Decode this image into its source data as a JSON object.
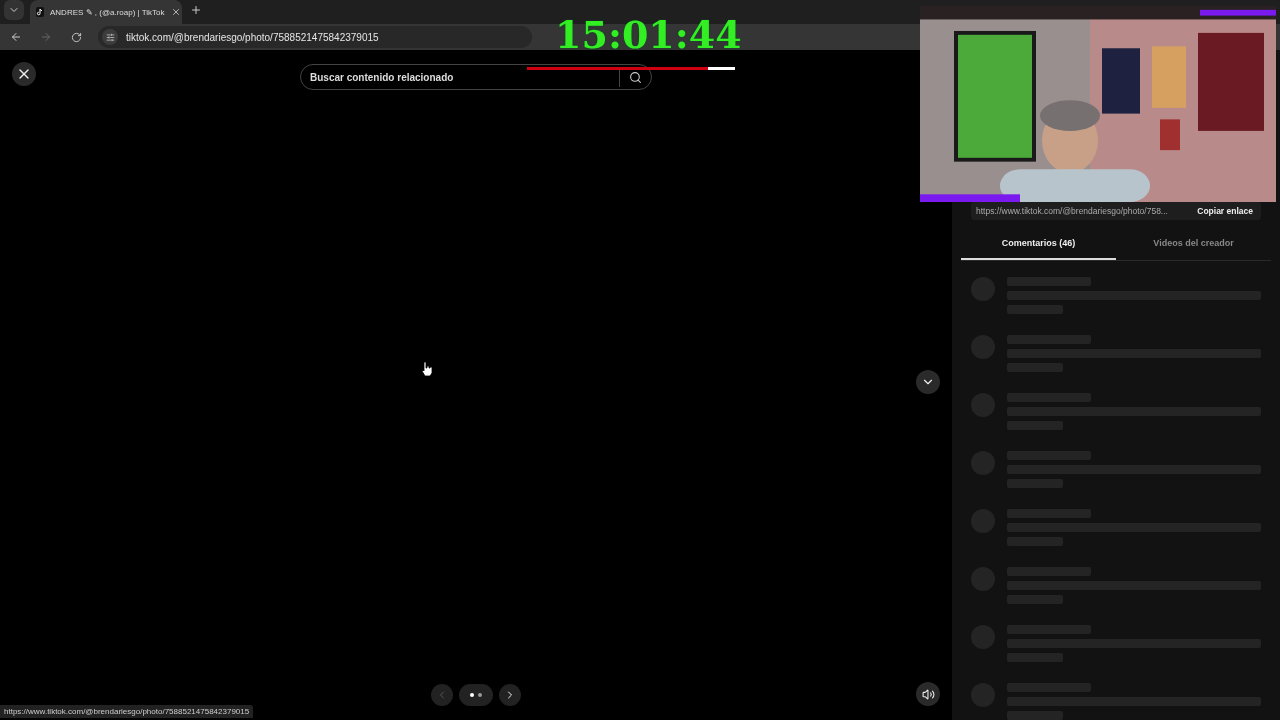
{
  "browser": {
    "tab": {
      "title": "ANDRES ✎ , (@a.roap) | TikTok",
      "selected": true
    },
    "nav": {
      "back_disabled": false,
      "forward_disabled": true
    },
    "url": "tiktok.com/@brendariesgo/photo/7588521475842379015"
  },
  "overlay": {
    "timer": "15:01:44",
    "progress": {
      "level": 0.87
    }
  },
  "viewer": {
    "search": {
      "placeholder": "Buscar contenido relacionado"
    },
    "carousel": {
      "prev_disabled": true,
      "next_disabled": false,
      "dots": [
        {
          "selected": true
        },
        {
          "selected": false
        }
      ]
    }
  },
  "side_panel": {
    "link": "https://www.tiktok.com/@brendariesgo/photo/758...",
    "copy_button": "Copiar enlace",
    "tabs": [
      {
        "label": "Comentarios (46)",
        "selected": true
      },
      {
        "label": "Videos del creador",
        "selected": false
      }
    ],
    "comments": [
      {
        "kind": "skeleton"
      },
      {
        "kind": "skeleton"
      },
      {
        "kind": "skeleton"
      },
      {
        "kind": "skeleton"
      },
      {
        "kind": "skeleton"
      },
      {
        "kind": "skeleton"
      },
      {
        "kind": "skeleton"
      },
      {
        "kind": "skeleton"
      }
    ]
  },
  "status_bar": {
    "url": "https://www.tiktok.com/@brendariesgo/photo/7588521475842379015"
  }
}
